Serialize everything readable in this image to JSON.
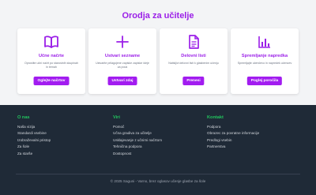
{
  "header": {
    "title": "Orodja za učitelje"
  },
  "cards": [
    {
      "icon": "book-icon",
      "title": "Učne načrte",
      "desc": "Oprostite učni načrt po starostnih skupinah in temah",
      "button": "Oglejte načrtov"
    },
    {
      "icon": "plus-icon",
      "title": "Ustvari sezname",
      "desc": "Ustvarite prilagojene zapiske zapiske ideje za pouk",
      "button": "Ustvari zdaj"
    },
    {
      "icon": "document-icon",
      "title": "Delovni listi",
      "desc": "Natisljivi delovni listi k glasbenim učenju",
      "button": "Prenesi"
    },
    {
      "icon": "bar-chart-icon",
      "title": "Spremljanje napredka",
      "desc": "Spremljajte učenčevo in napredek učencev",
      "button": "Poglej poročila"
    }
  ],
  "footer": {
    "columns": [
      {
        "title": "O nas",
        "links": [
          "Naša vizija",
          "Standardi vsebine",
          "Izobraževalni pristop",
          "Za šole",
          "Za starše"
        ]
      },
      {
        "title": "Viri",
        "links": [
          "Pomoč",
          "Učna gradiva za učitelje",
          "Usklajevanje z učnimi načrtom",
          "Tehnična podpora",
          "Dostopnost"
        ]
      },
      {
        "title": "Kontakt",
        "links": [
          "Podpora",
          "Obrazec za povratne informacije",
          "Predlogi vsebin",
          "Partnerstva"
        ]
      }
    ],
    "copyright": "© 2025 Saguni - Varno, brez oglasov učenje glasbe za šole"
  },
  "colors": {
    "accent": "#9b1fe8",
    "button": "#a21cf0",
    "footer_bg": "#1f2a37",
    "footer_heading": "#22c55e"
  }
}
